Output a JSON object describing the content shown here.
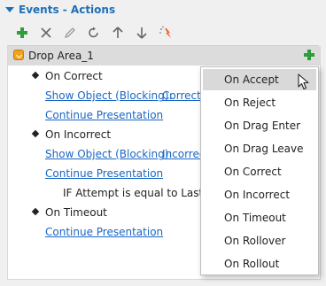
{
  "header": {
    "title": "Events - Actions"
  },
  "toolbar": {
    "buttons": [
      {
        "icon": "add-icon"
      },
      {
        "icon": "delete-icon"
      },
      {
        "icon": "edit-icon"
      },
      {
        "icon": "redo-icon"
      },
      {
        "icon": "move-up-icon"
      },
      {
        "icon": "move-down-icon"
      },
      {
        "icon": "magic-icon"
      }
    ]
  },
  "tree": {
    "drop_area": "Drop Area_1",
    "on_correct": "On Correct",
    "show_object_1": "Show Object (Blocking):",
    "show_object_1_target": "Correct",
    "continue_1": "Continue Presentation",
    "on_incorrect": "On Incorrect",
    "show_object_2": "Show Object (Blocking):",
    "show_object_2_target": "Incorrec",
    "continue_2": "Continue Presentation",
    "condition": "IF Attempt is equal to Last",
    "on_timeout": "On Timeout",
    "continue_3": "Continue Presentation"
  },
  "menu": {
    "items": [
      "On Accept",
      "On Reject",
      "On Drag Enter",
      "On Drag Leave",
      "On Correct",
      "On Incorrect",
      "On Timeout",
      "On Rollover",
      "On Rollout"
    ],
    "hovered": "On Accept"
  },
  "colors": {
    "accent": "#1f6fb8",
    "link": "#1a66c4",
    "add_green": "#2e9e3a"
  }
}
